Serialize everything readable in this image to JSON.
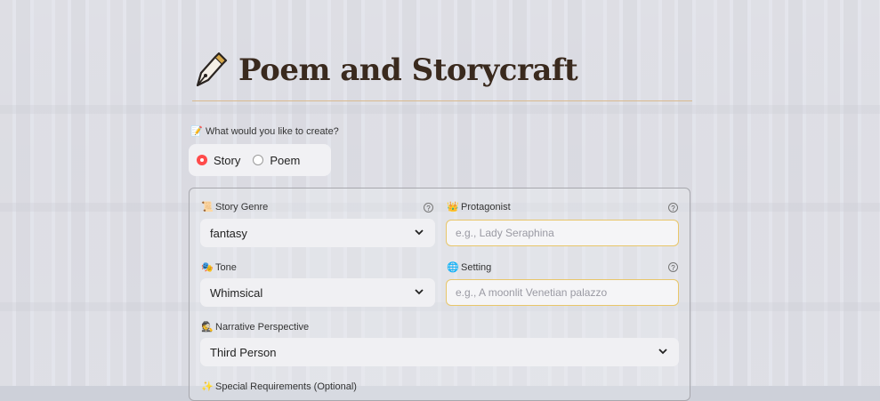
{
  "app": {
    "title": "Poem and Storycraft"
  },
  "create": {
    "question": "What would you like to create?",
    "options": [
      {
        "label": "Story",
        "selected": true
      },
      {
        "label": "Poem",
        "selected": false
      }
    ]
  },
  "form": {
    "genre": {
      "label": "Story Genre",
      "value": "fantasy",
      "help": "?"
    },
    "protagonist": {
      "label": "Protagonist",
      "placeholder": "e.g., Lady Seraphina",
      "help": "?"
    },
    "tone": {
      "label": "Tone",
      "value": "Whimsical"
    },
    "setting": {
      "label": "Setting",
      "placeholder": "e.g., A moonlit Venetian palazzo",
      "help": "?"
    },
    "perspective": {
      "label": "Narrative Perspective",
      "value": "Third Person"
    },
    "special": {
      "label": "Special Requirements (Optional)"
    }
  },
  "colors": {
    "accent": "#ff4b4b",
    "title": "#3a2a1e",
    "input_border": "#e8c66a",
    "rule": "#d9b98e"
  },
  "icons": {
    "title": "fountain-pen-icon",
    "question": "memo-icon",
    "genre": "scroll-icon",
    "protagonist": "crown-icon",
    "tone": "theater-masks-icon",
    "setting": "globe-icon",
    "perspective": "detective-icon",
    "special": "sparkle-icon"
  }
}
